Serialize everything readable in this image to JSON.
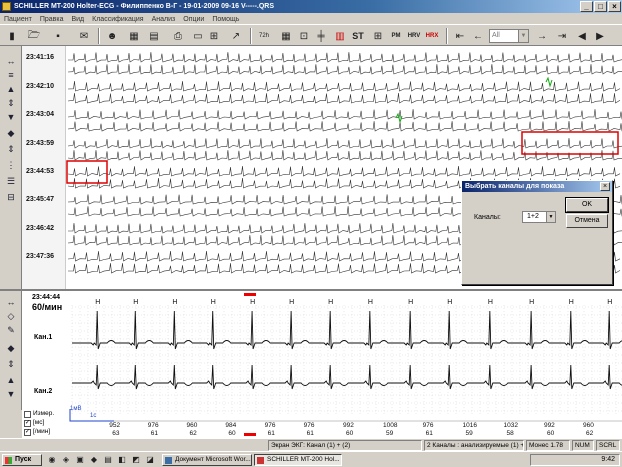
{
  "window": {
    "title": "SCHILLER MT-200 Holter-ECG - Филиппенко В-Г - 19-01-2009 09-16 V-----.QRS",
    "accent": "#0a246a",
    "controls": [
      "_",
      "□",
      "×"
    ]
  },
  "menu": [
    "Пациент",
    "Правка",
    "Вид",
    "Классификация",
    "Анализ",
    "Опции",
    "Помощь"
  ],
  "toolbar": {
    "combo_value": "All",
    "icons": [
      "bar-icon",
      "open-folder-icon",
      "save-icon",
      "mail-icon",
      "patient-icon",
      "report-icon",
      "document-icon",
      "print-icon",
      "preview-icon",
      "filter-icon",
      "zoom-icon",
      "time-icon",
      "table-icon",
      "ruler-icon",
      "split-icon",
      "st-icon",
      "pm-icon",
      "hrv-icon",
      "hrx-icon",
      "first-icon",
      "prev-icon",
      "next-icon",
      "last-icon"
    ],
    "labels": {
      "st": "ST",
      "pm": "PM",
      "hrv": "HRV",
      "hrx": "HRX",
      "t72": "72h"
    }
  },
  "overview": {
    "times": [
      "23:41:16",
      "23:42:10",
      "23:43:04",
      "23:43:59",
      "23:44:53",
      "23:45:47",
      "23:46:42",
      "23:47:36"
    ]
  },
  "detail": {
    "time": "23:44:44",
    "rate": "60/мин",
    "channels": [
      "Кан.1",
      "Кан.2"
    ],
    "scale": "1мВ",
    "scale_time": "1с",
    "beat_label": "H",
    "rr_values": [
      "980",
      "952",
      "976",
      "960",
      "984",
      "976",
      "976",
      "992",
      "1008",
      "976",
      "1016",
      "1032",
      "992",
      "960"
    ],
    "hr_values": [
      "60",
      "63",
      "61",
      "62",
      "60",
      "61",
      "61",
      "60",
      "59",
      "61",
      "59",
      "58",
      "60",
      "62"
    ]
  },
  "checkboxes": [
    {
      "label": "Измер.",
      "checked": false
    },
    {
      "label": "[мс]",
      "checked": true
    },
    {
      "label": "[/мин]",
      "checked": true
    }
  ],
  "dialog": {
    "title": "Выбрать каналы для показа",
    "channels_label": "Каналы:",
    "channels_value": "1+2",
    "ok": "OK",
    "cancel": "Отмена"
  },
  "statusbar": [
    "Экран ЭКГ: Канал (1) + (2)",
    "2 Каналы : анализируемые (1) + (",
    "Монес 1.78",
    "NUM",
    "SCRL"
  ],
  "taskbar": {
    "start": "Пуск",
    "tasks": [
      "Документ Microsoft Wor...",
      "SCHILLER MT-200 Hol..."
    ],
    "clock": "9:42"
  }
}
